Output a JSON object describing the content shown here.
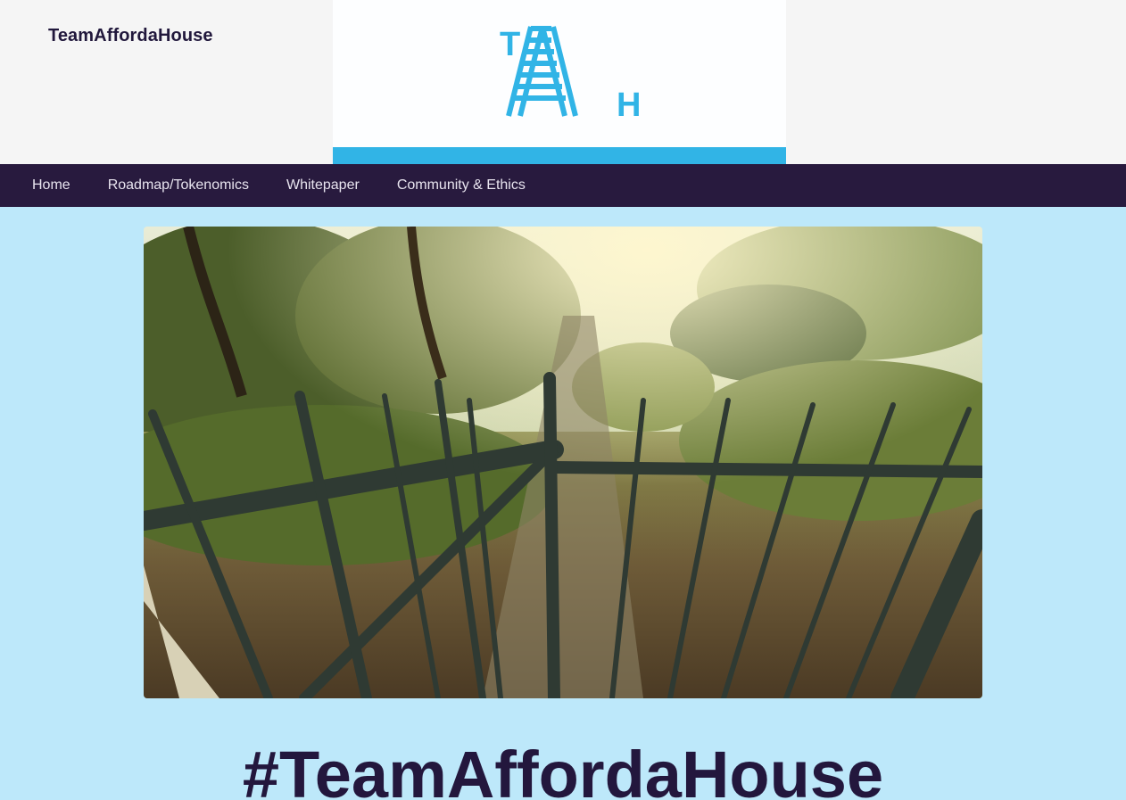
{
  "site": {
    "title": "TeamAffordaHouse"
  },
  "logo": {
    "letters": [
      "T",
      "A",
      "H"
    ],
    "color": "#31b4e6"
  },
  "nav": {
    "items": [
      {
        "label": "Home"
      },
      {
        "label": "Roadmap/Tokenomics"
      },
      {
        "label": "Whitepaper"
      },
      {
        "label": "Community & Ethics"
      }
    ],
    "background": "#281a3e"
  },
  "hero": {
    "image_subject": "open iron gate leading to overgrown garden path in morning sunlight"
  },
  "main": {
    "heading": "#TeamAffordaHouse",
    "background": "#bde8fa"
  }
}
